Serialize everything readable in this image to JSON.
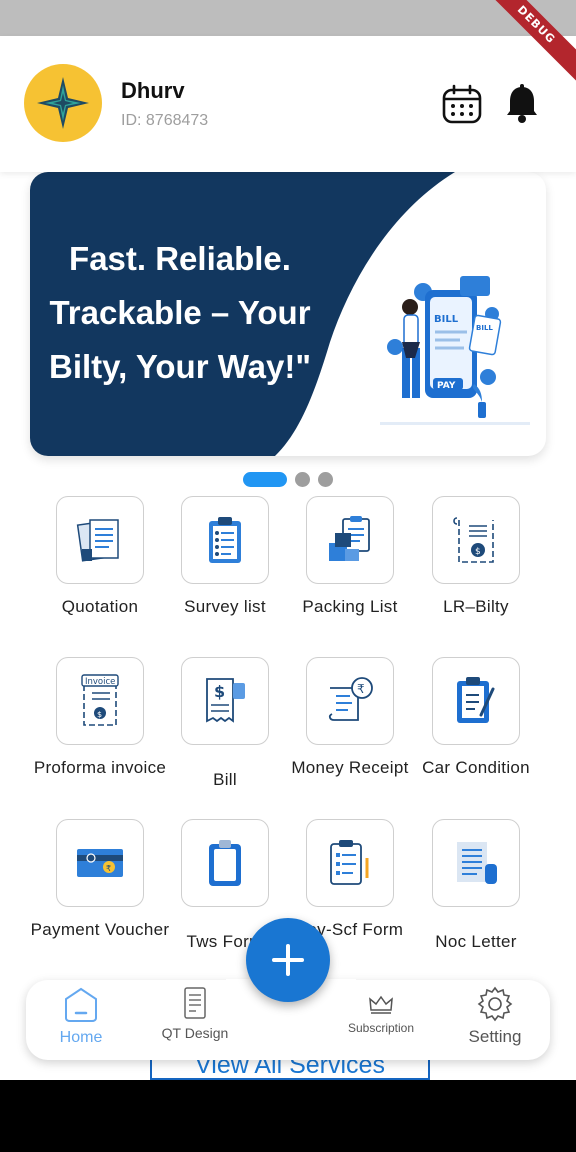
{
  "debug_label": "DEBUG",
  "user": {
    "name": "Dhurv",
    "id_text": "ID: 8768473"
  },
  "banner": {
    "line1": "Fast. Reliable.",
    "line2": "Trackable – Your",
    "line3": "Bilty, Your Way!\"",
    "bill_text": "BILL",
    "bill_text2": "BILL",
    "pay_text": "PAY"
  },
  "carousel": {
    "page_count": 3,
    "active_index": 0
  },
  "services": [
    {
      "label": "Quotation",
      "icon": "documents-icon"
    },
    {
      "label": "Survey list",
      "icon": "clipboard-list-icon"
    },
    {
      "label": "Packing List",
      "icon": "packing-list-icon"
    },
    {
      "label": "LR–Bilty",
      "icon": "receipt-icon"
    },
    {
      "label": "Proforma invoice",
      "icon": "invoice-icon"
    },
    {
      "label": "Bill",
      "icon": "bill-icon"
    },
    {
      "label": "Money Receipt",
      "icon": "money-receipt-icon"
    },
    {
      "label": "Car Condition",
      "icon": "car-condition-icon"
    },
    {
      "label": "Payment Voucher",
      "icon": "payment-voucher-icon"
    },
    {
      "label": "Tws Form",
      "icon": "tws-form-icon"
    },
    {
      "label": "Fov-Scf Form",
      "icon": "fov-form-icon"
    },
    {
      "label": "Noc Letter",
      "icon": "noc-letter-icon"
    }
  ],
  "invoice_tag": "Invoice",
  "view_all": "View All Services",
  "nav": {
    "home": "Home",
    "qt_design": "QT Design",
    "subscription": "Subscription",
    "setting": "Setting"
  },
  "colors": {
    "accent": "#1976d2",
    "banner_navy": "#12375f",
    "avatar_bg": "#f6c233"
  }
}
